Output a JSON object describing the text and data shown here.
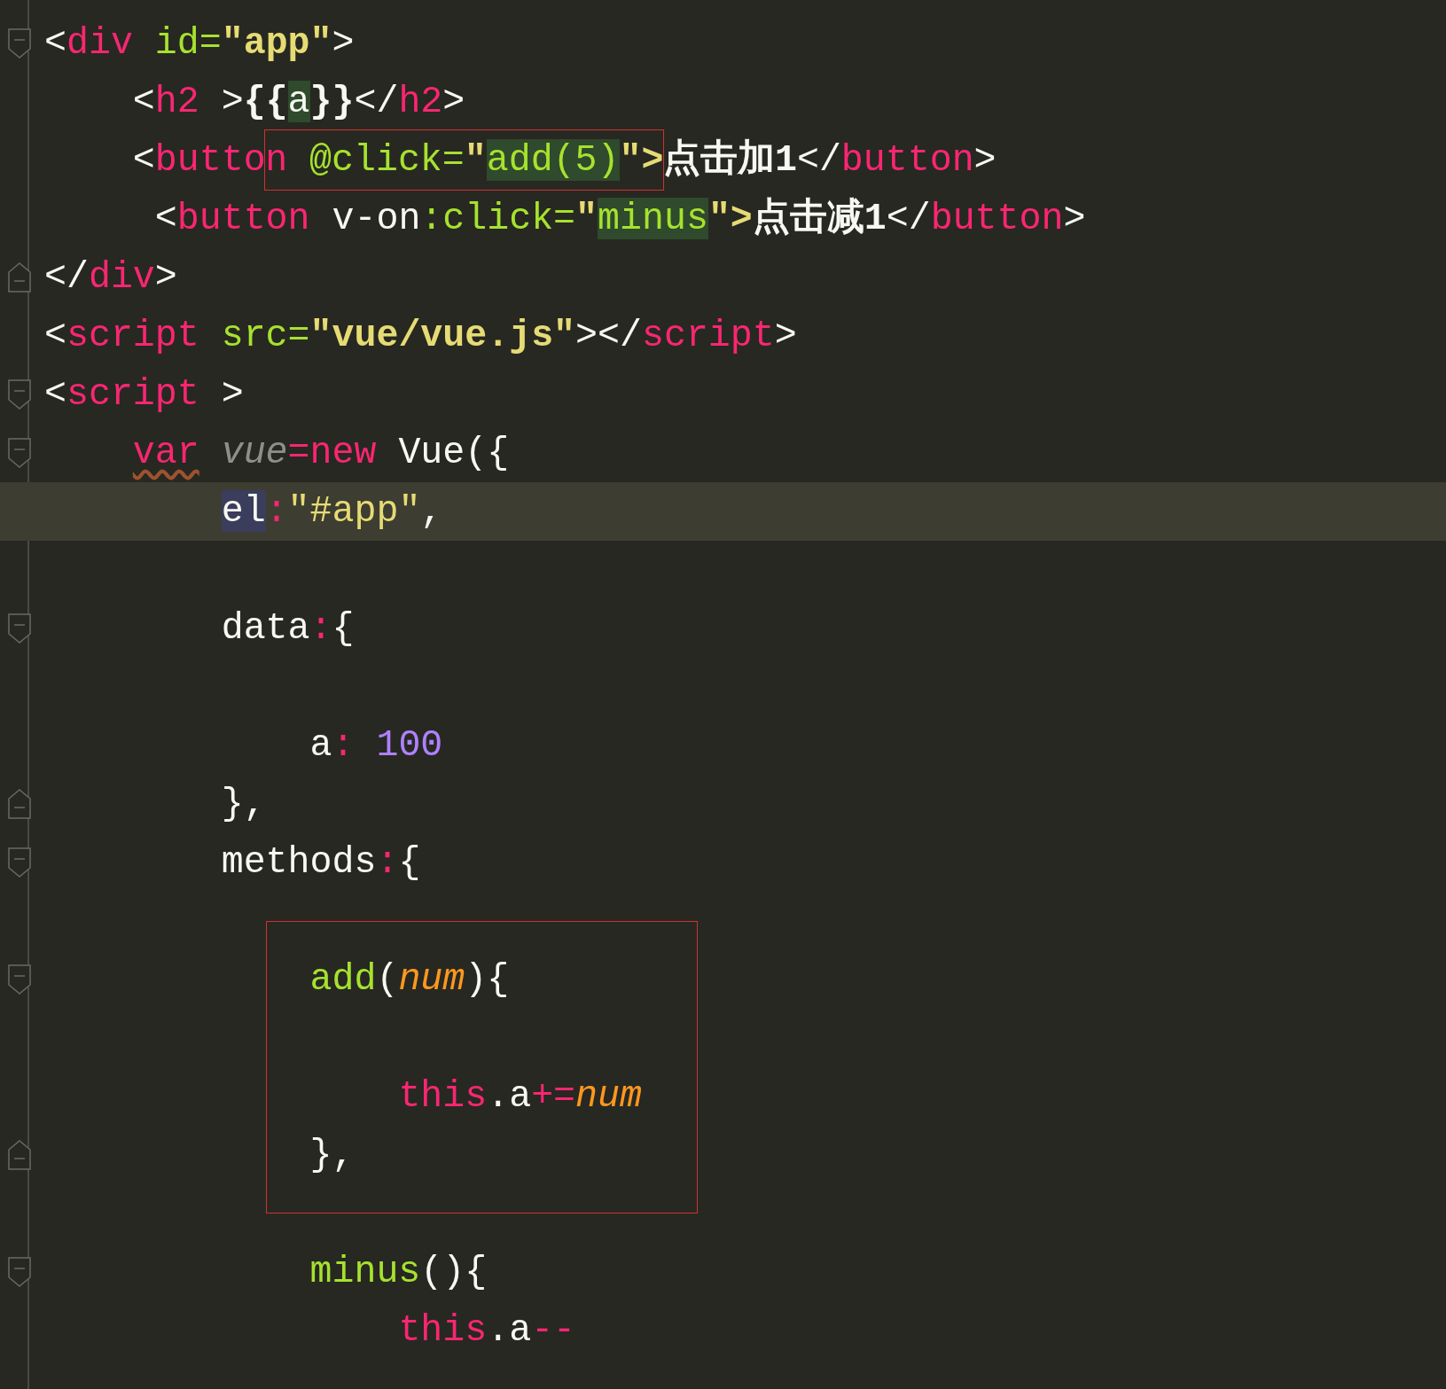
{
  "editor": {
    "blocks": [
      {
        "lines": [
          {
            "fold_start": true,
            "tokens": [
              {
                "text": "<",
                "kind": "plain"
              },
              {
                "text": "div",
                "kind": "tag"
              },
              {
                "text": " id=",
                "kind": "attr"
              },
              {
                "text": "\"app\"",
                "kind": "str"
              },
              {
                "text": ">",
                "kind": "plain"
              }
            ]
          },
          {
            "tokens": [
              {
                "text": "    <",
                "kind": "plain"
              },
              {
                "text": "h2",
                "kind": "tag"
              },
              {
                "text": " >",
                "kind": "plain"
              },
              {
                "text": "{{",
                "kind": "bold"
              },
              {
                "text": "a",
                "kind": "plain",
                "matched": true
              },
              {
                "text": "}}",
                "kind": "bold"
              },
              {
                "text": "</",
                "kind": "plain"
              },
              {
                "text": "h2",
                "kind": "tag"
              },
              {
                "text": ">",
                "kind": "plain"
              }
            ]
          },
          {
            "tokens": [
              {
                "text": "    <",
                "kind": "plain"
              },
              {
                "text": "butto",
                "kind": "tag"
              },
              {
                "text": "n",
                "kind": "tag",
                "boxed": true
              },
              {
                "text": " @click=",
                "kind": "attr",
                "boxed": true
              },
              {
                "text": "\"",
                "kind": "str",
                "boxed": true
              },
              {
                "text": "add(5)",
                "kind": "attr",
                "matched": true,
                "boxed": true
              },
              {
                "text": "\">",
                "kind": "str",
                "boxed": true
              },
              {
                "text": "点击加1",
                "kind": "bold"
              },
              {
                "text": "</",
                "kind": "plain"
              },
              {
                "text": "button",
                "kind": "tag"
              },
              {
                "text": ">",
                "kind": "plain"
              }
            ]
          },
          {
            "tokens": [
              {
                "text": "     <",
                "kind": "plain"
              },
              {
                "text": "button",
                "kind": "tag"
              },
              {
                "text": " v-on",
                "kind": "plain"
              },
              {
                "text": ":click=",
                "kind": "attr"
              },
              {
                "text": "\"",
                "kind": "str"
              },
              {
                "text": "minus",
                "kind": "attr",
                "matched": true
              },
              {
                "text": "\">",
                "kind": "str"
              },
              {
                "text": "点击减1",
                "kind": "bold"
              },
              {
                "text": "</",
                "kind": "plain"
              },
              {
                "text": "button",
                "kind": "tag"
              },
              {
                "text": ">",
                "kind": "plain"
              }
            ]
          },
          {
            "fold_end": true,
            "tokens": [
              {
                "text": "</",
                "kind": "plain"
              },
              {
                "text": "div",
                "kind": "tag"
              },
              {
                "text": ">",
                "kind": "plain"
              }
            ]
          },
          {
            "tokens": [
              {
                "text": "<",
                "kind": "plain"
              },
              {
                "text": "script",
                "kind": "tag"
              },
              {
                "text": " src=",
                "kind": "attr"
              },
              {
                "text": "\"vue/vue.js\"",
                "kind": "str"
              },
              {
                "text": "></",
                "kind": "plain"
              },
              {
                "text": "script",
                "kind": "tag"
              },
              {
                "text": ">",
                "kind": "plain"
              }
            ]
          },
          {
            "fold_start": true,
            "tokens": [
              {
                "text": "<",
                "kind": "plain"
              },
              {
                "text": "script",
                "kind": "tag"
              },
              {
                "text": " >",
                "kind": "plain"
              }
            ]
          },
          {
            "fold_start": true,
            "tokens": [
              {
                "text": "    var",
                "kind": "kw",
                "warning": true
              },
              {
                "text": " vue",
                "kind": "local"
              },
              {
                "text": "=new",
                "kind": "kw"
              },
              {
                "text": " Vue({",
                "kind": "plain"
              }
            ]
          },
          {
            "current": true,
            "tokens": [
              {
                "text": "        el",
                "kind": "plain",
                "occurrence": true
              },
              {
                "text": ":",
                "kind": "kw"
              },
              {
                "text": "\"#app\"",
                "kind": "jsstr"
              },
              {
                "text": ",",
                "kind": "plain"
              }
            ]
          }
        ]
      },
      {
        "lines": [
          {
            "fold_start": true,
            "tokens": [
              {
                "text": "        data",
                "kind": "plain"
              },
              {
                "text": ":",
                "kind": "kw"
              },
              {
                "text": "{",
                "kind": "plain"
              }
            ]
          }
        ]
      },
      {
        "lines": [
          {
            "tokens": [
              {
                "text": "            a",
                "kind": "plain"
              },
              {
                "text": ": ",
                "kind": "kw"
              },
              {
                "text": "100",
                "kind": "num"
              }
            ]
          },
          {
            "fold_end": true,
            "tokens": [
              {
                "text": "        },",
                "kind": "plain"
              }
            ]
          },
          {
            "fold_start": true,
            "tokens": [
              {
                "text": "        methods",
                "kind": "plain"
              },
              {
                "text": ":",
                "kind": "kw"
              },
              {
                "text": "{",
                "kind": "plain"
              }
            ]
          }
        ]
      },
      {
        "lines": [
          {
            "fold_start": true,
            "boxed": true,
            "tokens": [
              {
                "text": "            add",
                "kind": "attr"
              },
              {
                "text": "(",
                "kind": "plain"
              },
              {
                "text": "num",
                "kind": "param"
              },
              {
                "text": "){",
                "kind": "plain"
              }
            ]
          }
        ]
      },
      {
        "lines": [
          {
            "boxed": true,
            "tokens": [
              {
                "text": "                this",
                "kind": "kw"
              },
              {
                "text": ".a",
                "kind": "plain"
              },
              {
                "text": "+=",
                "kind": "kw"
              },
              {
                "text": "num",
                "kind": "param"
              }
            ]
          },
          {
            "fold_end": true,
            "boxed": true,
            "tokens": [
              {
                "text": "            },",
                "kind": "plain"
              }
            ]
          }
        ]
      },
      {
        "lines": [
          {
            "fold_start": true,
            "tokens": [
              {
                "text": "            minus",
                "kind": "attr"
              },
              {
                "text": "(){",
                "kind": "plain"
              }
            ]
          },
          {
            "tokens": [
              {
                "text": "                this",
                "kind": "kw"
              },
              {
                "text": ".a",
                "kind": "plain"
              },
              {
                "text": "--",
                "kind": "kw"
              }
            ]
          }
        ]
      }
    ]
  }
}
